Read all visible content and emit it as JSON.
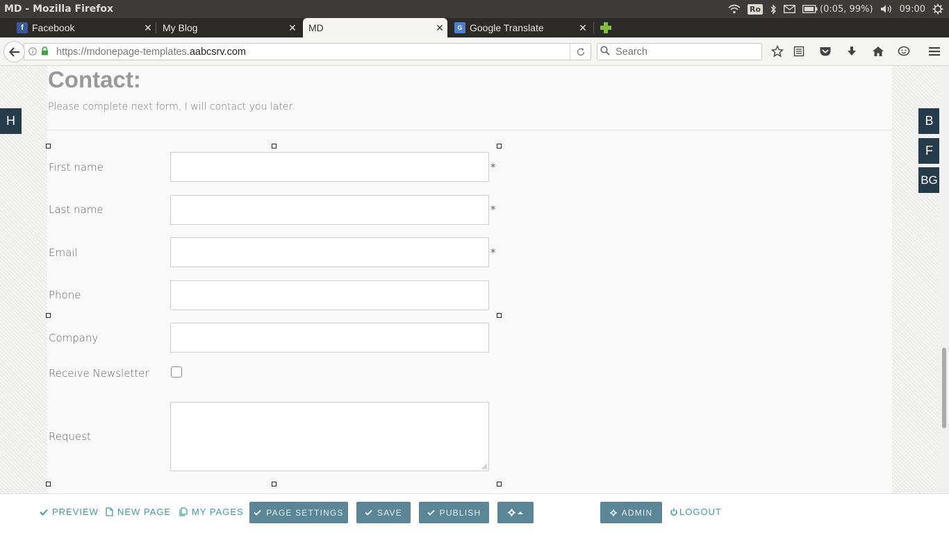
{
  "os": {
    "window_title": "MD - Mozilla Firefox",
    "keyboard_layout": "Ro",
    "battery": "(0:05, 99%)",
    "clock": "09:00"
  },
  "tabs": [
    {
      "label": "Facebook",
      "icon": "facebook-icon"
    },
    {
      "label": "My Blog",
      "icon": ""
    },
    {
      "label": "MD",
      "icon": "",
      "active": true
    },
    {
      "label": "Google Translate",
      "icon": "google-translate-icon"
    }
  ],
  "navbar": {
    "url_prefix": "https://mdonepage-templates.",
    "url_domain": "aabcsrv.com",
    "search_placeholder": "Search"
  },
  "page": {
    "title": "Contact:",
    "subtitle": "Please complete next form, I will contact you later.",
    "fields": [
      {
        "label": "First name",
        "required_mark": "*"
      },
      {
        "label": "Last name",
        "required_mark": "*"
      },
      {
        "label": "Email",
        "required_mark": "*"
      },
      {
        "label": "Phone",
        "required_mark": ""
      },
      {
        "label": "Company",
        "required_mark": ""
      }
    ],
    "newsletter_label": "Receive Newsletter",
    "newsletter_checked": false,
    "request_label": "Request"
  },
  "side_tabs": {
    "left": "H",
    "right": [
      "B",
      "F",
      "BG"
    ]
  },
  "toolbar": {
    "preview": "PREVIEW",
    "new_page": "NEW PAGE",
    "my_pages": "MY PAGES",
    "page_settings": "PAGE SETTINGS",
    "save": "SAVE",
    "publish": "PUBLISH",
    "admin": "ADMIN",
    "logout": "LOGOUT"
  },
  "colors": {
    "accent": "#3f9e94",
    "button_bg": "#5b8697",
    "side_tab_bg": "#263b4a"
  }
}
